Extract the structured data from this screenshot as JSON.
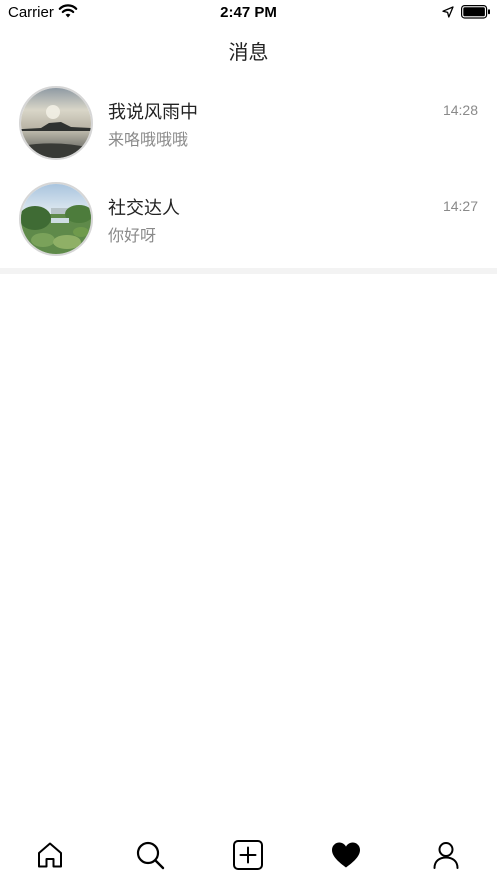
{
  "status_bar": {
    "carrier": "Carrier",
    "time": "2:47 PM"
  },
  "nav": {
    "title": "消息"
  },
  "conversations": [
    {
      "name": "我说风雨中",
      "preview": "来咯哦哦哦",
      "time": "14:28",
      "avatar": "sunset-lake-photo"
    },
    {
      "name": "社交达人",
      "preview": "你好呀",
      "time": "14:27",
      "avatar": "garden-photo"
    }
  ],
  "tabbar": {
    "items": [
      {
        "icon": "home-icon",
        "active": false
      },
      {
        "icon": "search-icon",
        "active": false
      },
      {
        "icon": "add-icon",
        "active": false
      },
      {
        "icon": "heart-icon",
        "active": true
      },
      {
        "icon": "profile-icon",
        "active": false
      }
    ]
  },
  "colors": {
    "background": "#ffffff",
    "primary_text": "#222222",
    "secondary_text": "#8a8a8a",
    "divider": "#f3f3f3"
  }
}
